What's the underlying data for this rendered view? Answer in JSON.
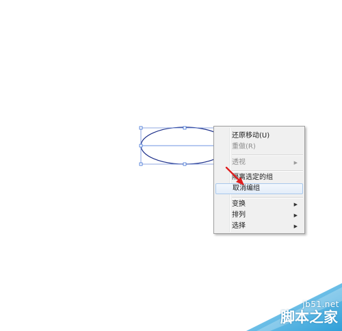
{
  "menu": {
    "items": [
      {
        "label": "还原移动(U)",
        "enabled": true,
        "submenu": false
      },
      {
        "label": "重做(R)",
        "enabled": false,
        "submenu": false
      },
      {
        "label": "透视",
        "enabled": false,
        "submenu": true
      },
      {
        "label": "隔离选定的组",
        "enabled": true,
        "submenu": false
      },
      {
        "label": "取消编组",
        "enabled": true,
        "submenu": false,
        "highlighted": true
      },
      {
        "label": "变换",
        "enabled": true,
        "submenu": true
      },
      {
        "label": "排列",
        "enabled": true,
        "submenu": true
      },
      {
        "label": "选择",
        "enabled": true,
        "submenu": true
      }
    ],
    "submenu_glyph": "▶"
  },
  "watermark": {
    "url": "jb51.net",
    "name": "脚本之家"
  },
  "colors": {
    "ellipse_stroke": "#1c2f8a",
    "selection": "#3b6fd6",
    "arrow": "#e01e1e",
    "watermark_blue": "#3aa6e0"
  }
}
